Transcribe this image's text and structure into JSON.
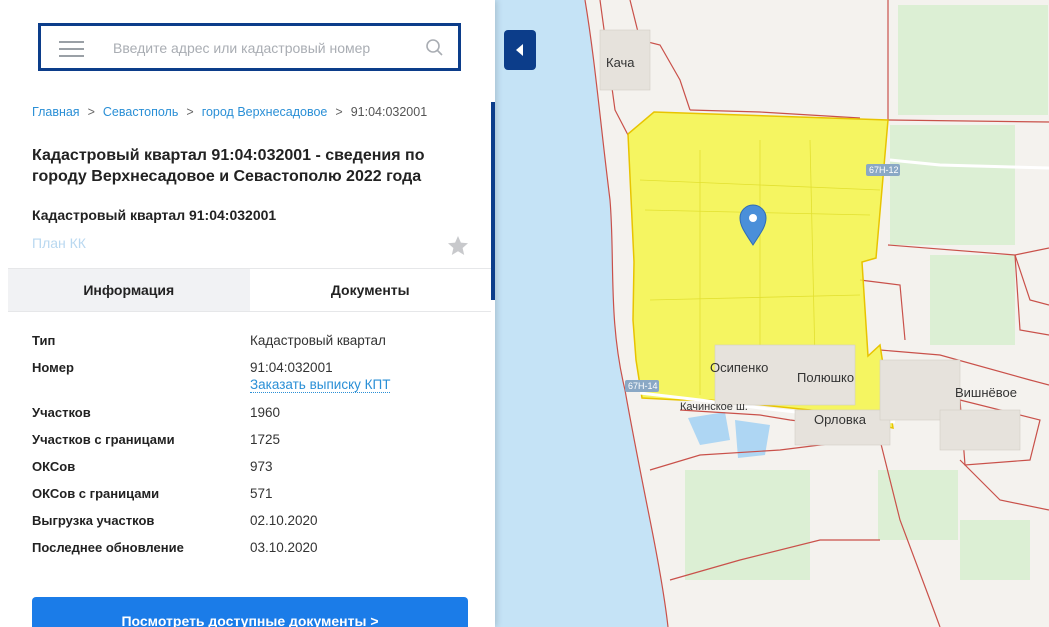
{
  "search": {
    "placeholder": "Введите адрес или кадастровый номер"
  },
  "breadcrumb": [
    {
      "label": "Главная"
    },
    {
      "label": "Севастополь"
    },
    {
      "label": "город Верхнесадовое"
    },
    {
      "label": "91:04:032001"
    }
  ],
  "breadcrumb_separator": ">",
  "title": "Кадастровый квартал 91:04:032001 - сведения по городу Верхнесадовое и Севастополю 2022 года",
  "subtitle": "Кадастровый квартал 91:04:032001",
  "plan_link": "План КК",
  "tabs": [
    {
      "label": "Информация",
      "active": true
    },
    {
      "label": "Документы",
      "active": false
    }
  ],
  "info": [
    {
      "key": "Тип",
      "value": "Кадастровый квартал"
    },
    {
      "key": "Номер",
      "value": "91:04:032001",
      "link": "Заказать выписку КПТ"
    },
    {
      "key": "Участков",
      "value": "1960"
    },
    {
      "key": "Участков с границами",
      "value": "1725"
    },
    {
      "key": "ОКСов",
      "value": "973"
    },
    {
      "key": "ОКСов с границами",
      "value": "571"
    },
    {
      "key": "Выгрузка участков",
      "value": "02.10.2020"
    },
    {
      "key": "Последнее обновление",
      "value": "03.10.2020"
    }
  ],
  "docs_button": "Посмотреть доступные документы >",
  "map": {
    "places": [
      "Кача",
      "Осипенко",
      "Полюшко",
      "Орловка",
      "Вишнёвое",
      "Качинское ш."
    ],
    "roads": [
      "67Н-12",
      "67Н-14"
    ]
  },
  "colors": {
    "accent": "#0c3d8a",
    "link": "#2a8fd6",
    "button": "#1b7ce8",
    "highlight": "#f5f542",
    "sea": "#c5e3f6",
    "marker": "#4a8fd9"
  }
}
